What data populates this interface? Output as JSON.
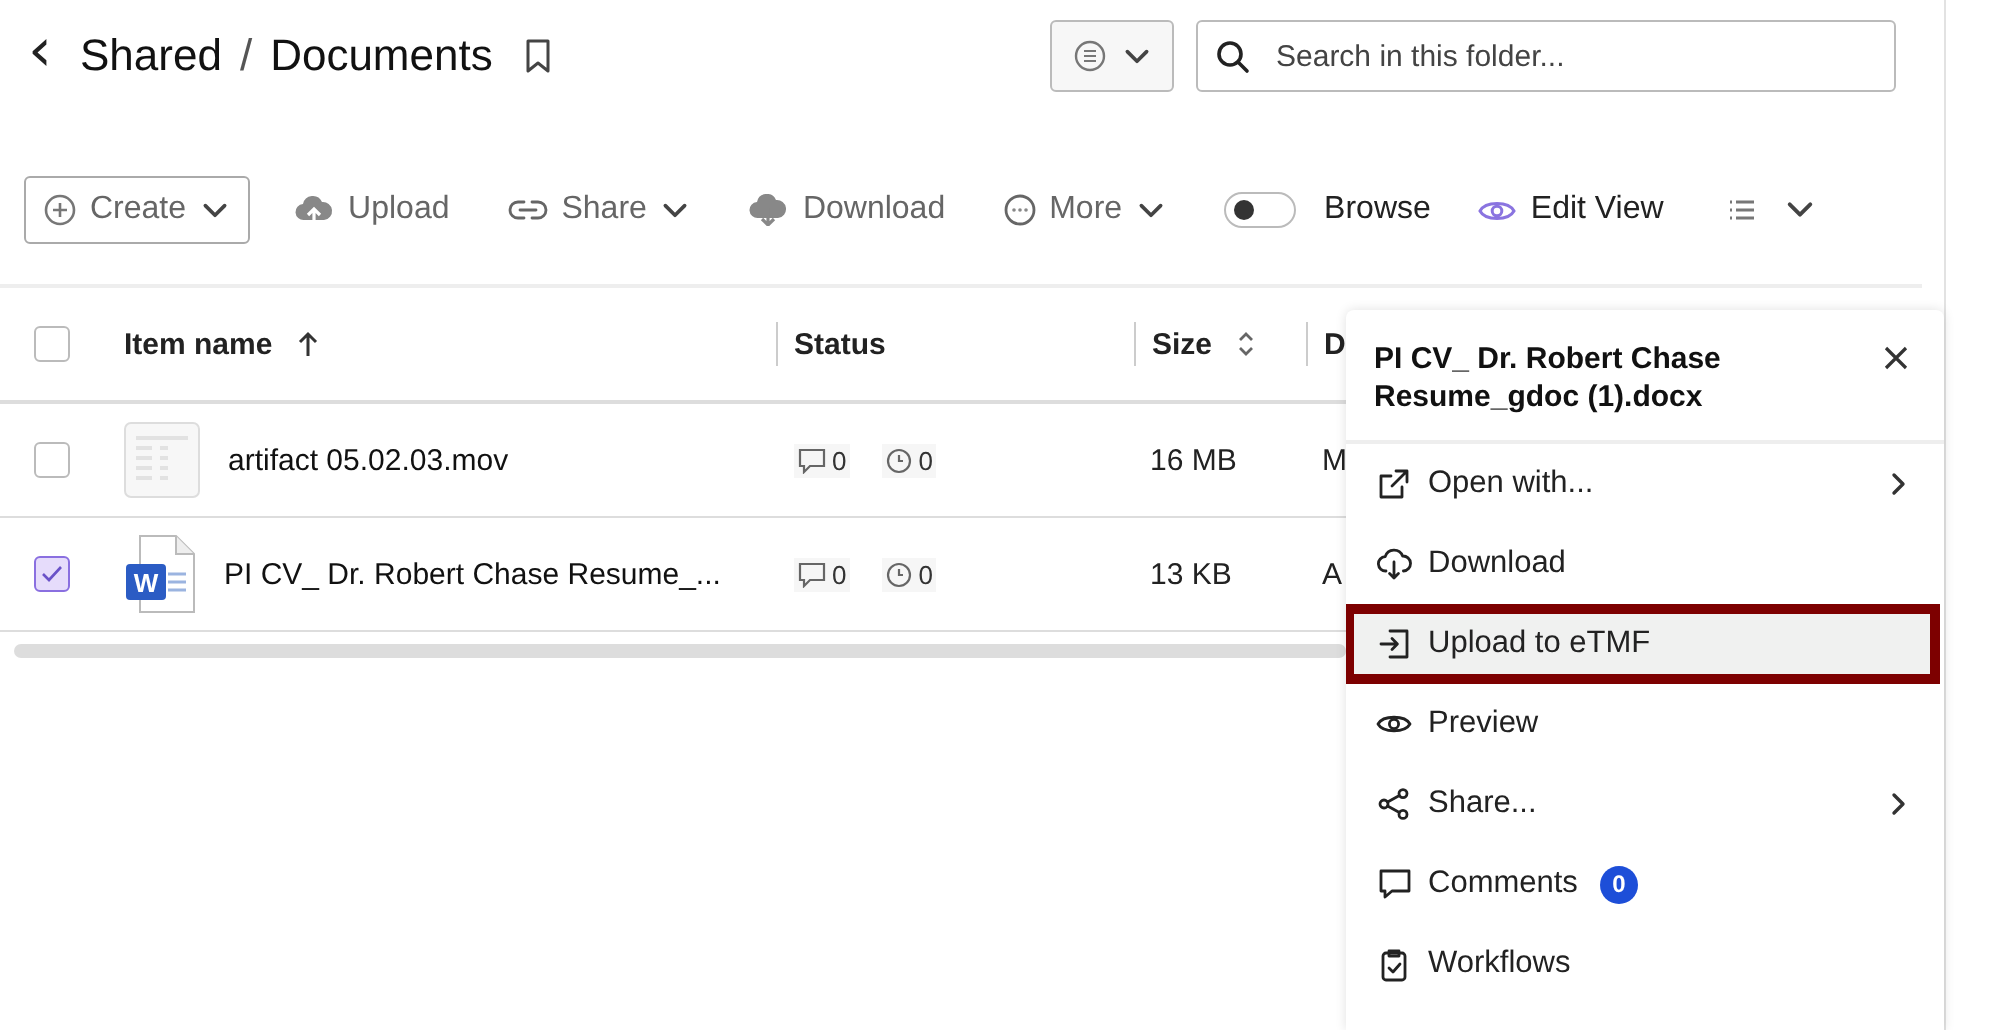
{
  "header": {
    "back": "‹",
    "breadcrumb": [
      {
        "label": "Shared"
      },
      {
        "label": "Documents"
      }
    ],
    "separator": "/",
    "bookmarked": false
  },
  "search": {
    "placeholder": "Search in this folder..."
  },
  "toolbar": [
    {
      "kind": "dropdown-button",
      "label": "Create"
    },
    {
      "kind": "action",
      "label": "Upload",
      "dropdown": false
    },
    {
      "kind": "action",
      "label": "Share",
      "dropdown": true
    },
    {
      "kind": "action",
      "label": "Download",
      "dropdown": false
    },
    {
      "kind": "action",
      "label": "More",
      "dropdown": true
    },
    {
      "kind": "toggle",
      "label": "Browse",
      "on": false
    },
    {
      "kind": "view",
      "label": "Edit View"
    },
    {
      "kind": "list-menu"
    }
  ],
  "table": {
    "all_checked": false,
    "columns": [
      {
        "label": "Item name"
      },
      {
        "label": "Status"
      },
      {
        "label": "Size"
      },
      {
        "label": "D"
      }
    ],
    "rows": [
      {
        "checked": false,
        "kind": "video",
        "name": "artifact 05.02.03.mov",
        "comments": "0",
        "tasks": "0",
        "size": "16 MB",
        "column_4": "M"
      },
      {
        "checked": true,
        "kind": "word",
        "icon_letter": "W",
        "name": "PI CV_ Dr. Robert Chase Resume_...",
        "comments": "0",
        "tasks": "0",
        "size": "13 KB",
        "column_4": "A"
      }
    ]
  },
  "context_menu": {
    "title": "PI CV_ Dr. Robert Chase Resume_gdoc (1).docx",
    "items": [
      {
        "label": "Open with...",
        "submenu": true,
        "selected": false
      },
      {
        "label": "Download",
        "submenu": false,
        "selected": false
      },
      {
        "label": "Upload to eTMF",
        "submenu": false,
        "selected": true
      },
      {
        "label": "Preview",
        "submenu": false,
        "selected": false
      },
      {
        "label": "Share...",
        "submenu": true,
        "selected": false
      },
      {
        "label": "Comments",
        "badge": "0",
        "submenu": false,
        "selected": false
      },
      {
        "label": "Workflows",
        "submenu": false,
        "selected": false
      }
    ]
  }
}
